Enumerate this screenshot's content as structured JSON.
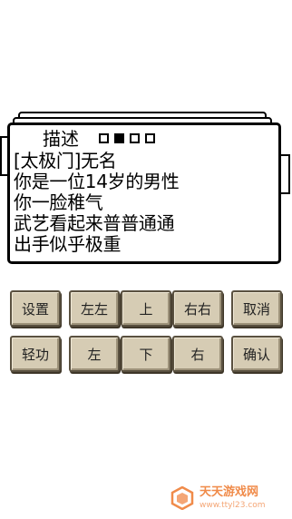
{
  "description_panel": {
    "title": "描述",
    "pager": {
      "total": 4,
      "active_index": 1
    },
    "lines": [
      "[太极门]无名",
      "你是一位14岁的男性",
      "你一脸稚气",
      "武艺看起来普普通通",
      "出手似乎极重"
    ]
  },
  "controls": {
    "settings_label": "设置",
    "left_left_label": "左左",
    "up_label": "上",
    "right_right_label": "右右",
    "cancel_label": "取消",
    "qinggong_label": "轻功",
    "left_label": "左",
    "down_label": "下",
    "right_label": "右",
    "confirm_label": "确认"
  },
  "watermark": {
    "text": "天天游戏网",
    "url": "www.ttyl23.com",
    "color": "#f08b4a"
  }
}
